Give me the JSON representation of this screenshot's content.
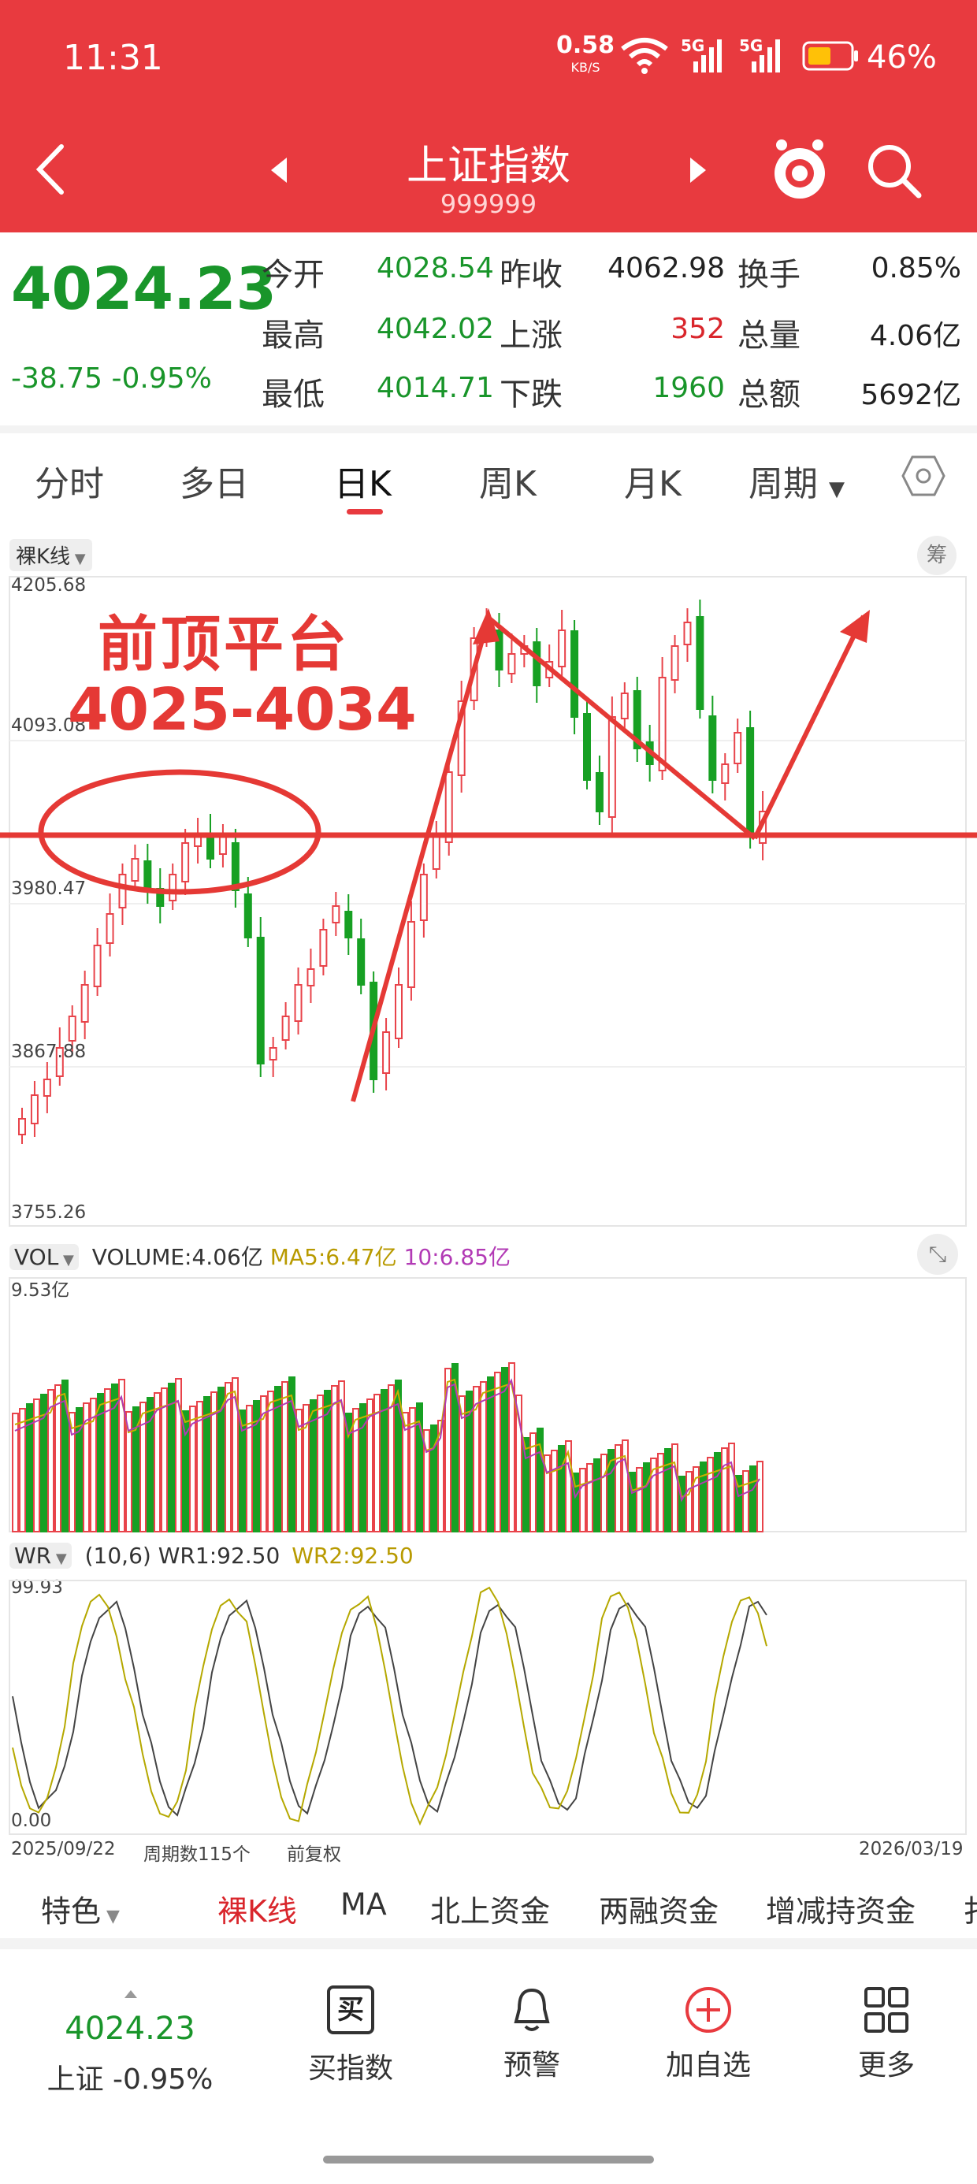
{
  "status_bar": {
    "time": "11:31",
    "net_speed": "0.58",
    "net_unit": "KB/S",
    "signal_1": "5G",
    "signal_2": "5G",
    "battery": "46%"
  },
  "nav": {
    "title": "上证指数",
    "code": "999999"
  },
  "quote": {
    "price": "4024.23",
    "change": "-38.75",
    "change_pct": "-0.95%",
    "rows": [
      {
        "l1": "今开",
        "v1": "4028.54",
        "l2": "昨收",
        "v2": "4062.98",
        "l3": "换手",
        "v3": "0.85%"
      },
      {
        "l1": "最高",
        "v1": "4042.02",
        "l2": "上涨",
        "v2": "352",
        "l3": "总量",
        "v3": "4.06亿"
      },
      {
        "l1": "最低",
        "v1": "4014.71",
        "l2": "下跌",
        "v2": "1960",
        "l3": "总额",
        "v3": "5692亿"
      }
    ]
  },
  "tabs": [
    "分时",
    "多日",
    "日K",
    "周K",
    "月K",
    "周期"
  ],
  "kline": {
    "tag": "裸K线",
    "tag_right": "筹",
    "y_labels": [
      "4205.68",
      "4093.08",
      "3980.47",
      "3867.88",
      "3755.26"
    ],
    "annotation_line1": "前顶平台",
    "annotation_line2": "4025-4034",
    "colors": {
      "up": "#e8434a",
      "down": "#17a023",
      "annotation": "#e53935"
    }
  },
  "volume": {
    "tag": "VOL",
    "label": "VOLUME:4.06亿",
    "ma5": "MA5:6.47亿",
    "ma10": "10:6.85亿",
    "max_label": "9.53亿"
  },
  "wr": {
    "tag": "WR",
    "params": "(10,6)",
    "wr1": "WR1:92.50",
    "wr2": "WR2:92.50",
    "top": "99.93",
    "bottom": "0.00"
  },
  "date_bar": {
    "start": "2025/09/22",
    "periods": "周期数115个",
    "adj": "前复权",
    "end": "2026/03/19"
  },
  "feature_bar": [
    "特色",
    "裸K线",
    "MA",
    "北上资金",
    "两融资金",
    "增减持资金",
    "扌"
  ],
  "bottom_bar": {
    "price": "4024.23",
    "name_change": "上证 -0.95%",
    "actions": [
      "买指数",
      "预警",
      "加自选",
      "更多"
    ],
    "buy_glyph": "买"
  }
}
